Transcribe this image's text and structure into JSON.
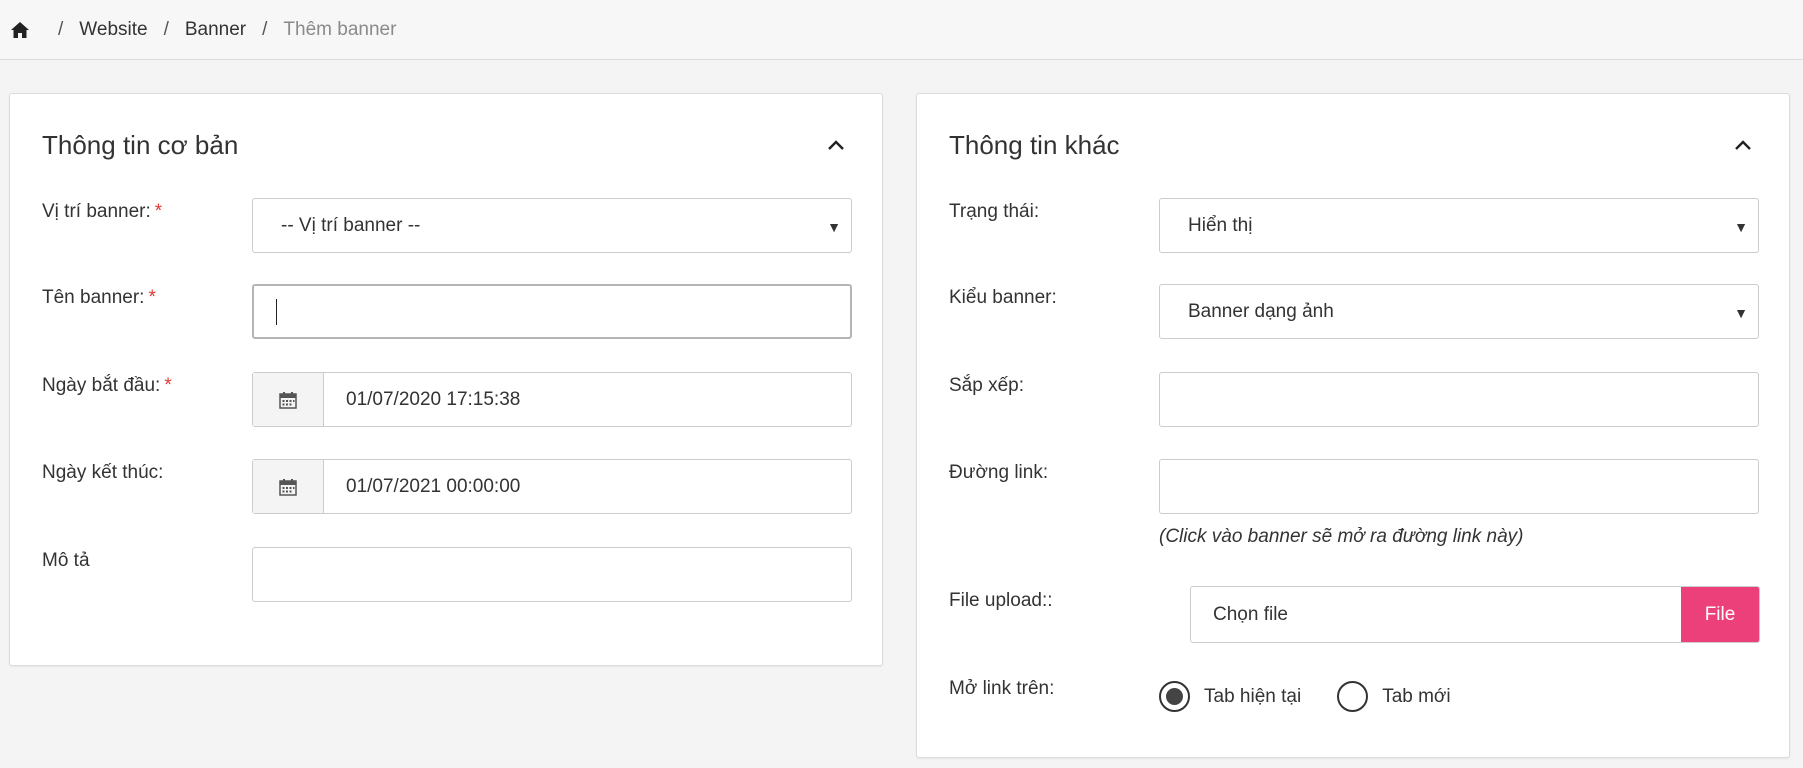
{
  "breadcrumb": {
    "items": [
      "Website",
      "Banner"
    ],
    "current": "Thêm banner",
    "separator": "/"
  },
  "left_panel": {
    "title": "Thông tin cơ bản",
    "fields": {
      "position": {
        "label": "Vị trí banner:",
        "value": "-- Vị trí banner --"
      },
      "name": {
        "label": "Tên banner:",
        "value": ""
      },
      "start_date": {
        "label": "Ngày bắt đầu:",
        "value": "01/07/2020 17:15:38"
      },
      "end_date": {
        "label": "Ngày kết thúc:",
        "value": "01/07/2021 00:00:00"
      },
      "description": {
        "label": "Mô tả",
        "value": ""
      }
    },
    "required_mark": "*"
  },
  "right_panel": {
    "title": "Thông tin khác",
    "fields": {
      "status": {
        "label": "Trạng thái:",
        "value": "Hiển thị"
      },
      "banner_type": {
        "label": "Kiểu banner:",
        "value": "Banner dạng ảnh"
      },
      "sort": {
        "label": "Sắp xếp:",
        "value": ""
      },
      "link": {
        "label": "Đường link:",
        "value": "",
        "hint": "(Click vào banner sẽ mở ra đường link này)"
      },
      "file_upload": {
        "label": "File upload::",
        "placeholder": "Chọn file",
        "button": "File"
      },
      "open_link": {
        "label": "Mở link trên:",
        "options": [
          "Tab hiện tại",
          "Tab mới"
        ],
        "selected": "Tab hiện tại"
      }
    }
  },
  "colors": {
    "accent_file_button": "#ec407a",
    "required": "#e53935",
    "breadcrumb_current": "#8a8a8a"
  },
  "icons": {
    "home": "home-icon",
    "collapse": "chevron-up-icon",
    "calendar": "calendar-icon",
    "select": "caret-down-icon"
  }
}
